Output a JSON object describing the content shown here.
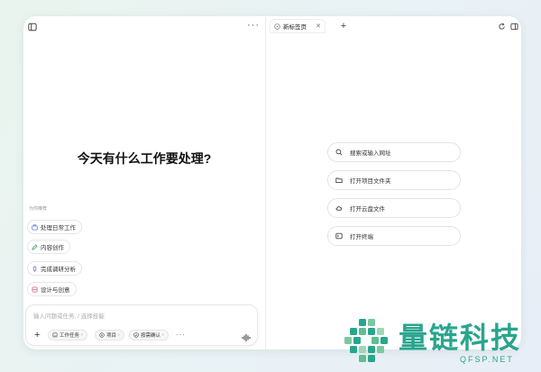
{
  "left_panel": {
    "heading": "今天有什么工作要处理?",
    "suggestions_caption": "为你推荐",
    "suggestions": [
      {
        "label": "处理日常工作",
        "icon": "briefcase-icon",
        "color": "#5b7bd6"
      },
      {
        "label": "内容创作",
        "icon": "pen-icon",
        "color": "#3aa66b"
      },
      {
        "label": "完成调研分析",
        "icon": "rocket-icon",
        "color": "#8a56d8"
      },
      {
        "label": "设计与创意",
        "icon": "palette-icon",
        "color": "#d65b8a"
      }
    ],
    "composer": {
      "placeholder": "输入问题或任务, / 选择技能",
      "mode_pill": "工作任务",
      "project_pill": "项目",
      "confirm_pill": "按需确认"
    }
  },
  "right_panel": {
    "tab_title": "新标签页",
    "actions": [
      {
        "label": "搜索或输入网址",
        "icon": "search-icon"
      },
      {
        "label": "打开项目文件夹",
        "icon": "folder-icon"
      },
      {
        "label": "打开云盘文件",
        "icon": "cloud-icon"
      },
      {
        "label": "打开终端",
        "icon": "terminal-icon"
      }
    ]
  },
  "watermark": {
    "title": "量链科技",
    "subtitle": "QFSP.NET",
    "color": "#2aa58d"
  }
}
